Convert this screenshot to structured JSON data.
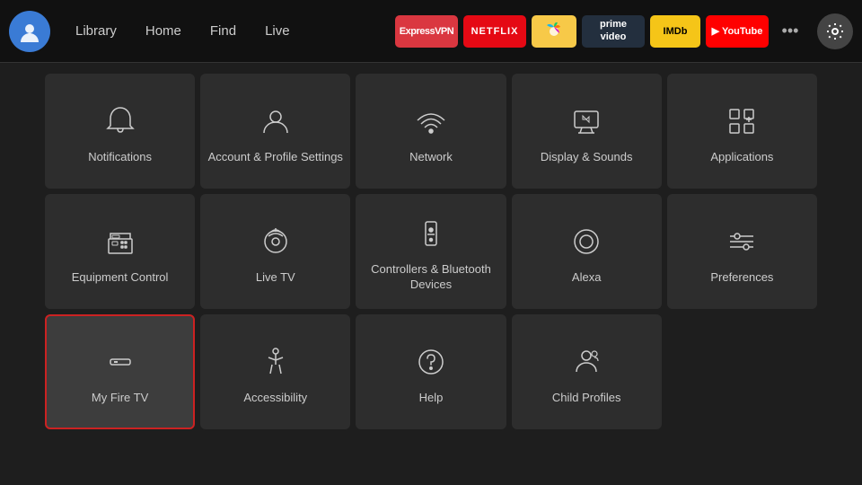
{
  "nav": {
    "links": [
      "Library",
      "Home",
      "Find",
      "Live"
    ],
    "apps": [
      {
        "name": "ExpressVPN",
        "label": "ExpressVPN",
        "color": "#da3740",
        "textColor": "#fff"
      },
      {
        "name": "Netflix",
        "label": "NETFLIX",
        "color": "#e50914",
        "textColor": "#fff"
      },
      {
        "name": "Peacock",
        "label": "🦚",
        "color": "#f7c948",
        "textColor": "#000"
      },
      {
        "name": "PrimeVideo",
        "label": "prime\nvideo",
        "color": "#232f3e",
        "textColor": "#fff"
      },
      {
        "name": "IMDb",
        "label": "IMDb",
        "color": "#f5c518",
        "textColor": "#000"
      },
      {
        "name": "YouTube",
        "label": "▶ YouTube",
        "color": "#ff0000",
        "textColor": "#fff"
      }
    ],
    "more_label": "•••",
    "settings_label": "⚙"
  },
  "tiles": {
    "row1": [
      {
        "id": "notifications",
        "label": "Notifications"
      },
      {
        "id": "account-profile",
        "label": "Account & Profile Settings"
      },
      {
        "id": "network",
        "label": "Network"
      },
      {
        "id": "display-sounds",
        "label": "Display & Sounds"
      },
      {
        "id": "applications",
        "label": "Applications"
      }
    ],
    "row2": [
      {
        "id": "equipment-control",
        "label": "Equipment Control"
      },
      {
        "id": "live-tv",
        "label": "Live TV"
      },
      {
        "id": "controllers-bluetooth",
        "label": "Controllers & Bluetooth Devices"
      },
      {
        "id": "alexa",
        "label": "Alexa"
      },
      {
        "id": "preferences",
        "label": "Preferences"
      }
    ],
    "row3": [
      {
        "id": "my-fire-tv",
        "label": "My Fire TV",
        "selected": true
      },
      {
        "id": "accessibility",
        "label": "Accessibility"
      },
      {
        "id": "help",
        "label": "Help"
      },
      {
        "id": "child-profiles",
        "label": "Child Profiles"
      }
    ]
  }
}
